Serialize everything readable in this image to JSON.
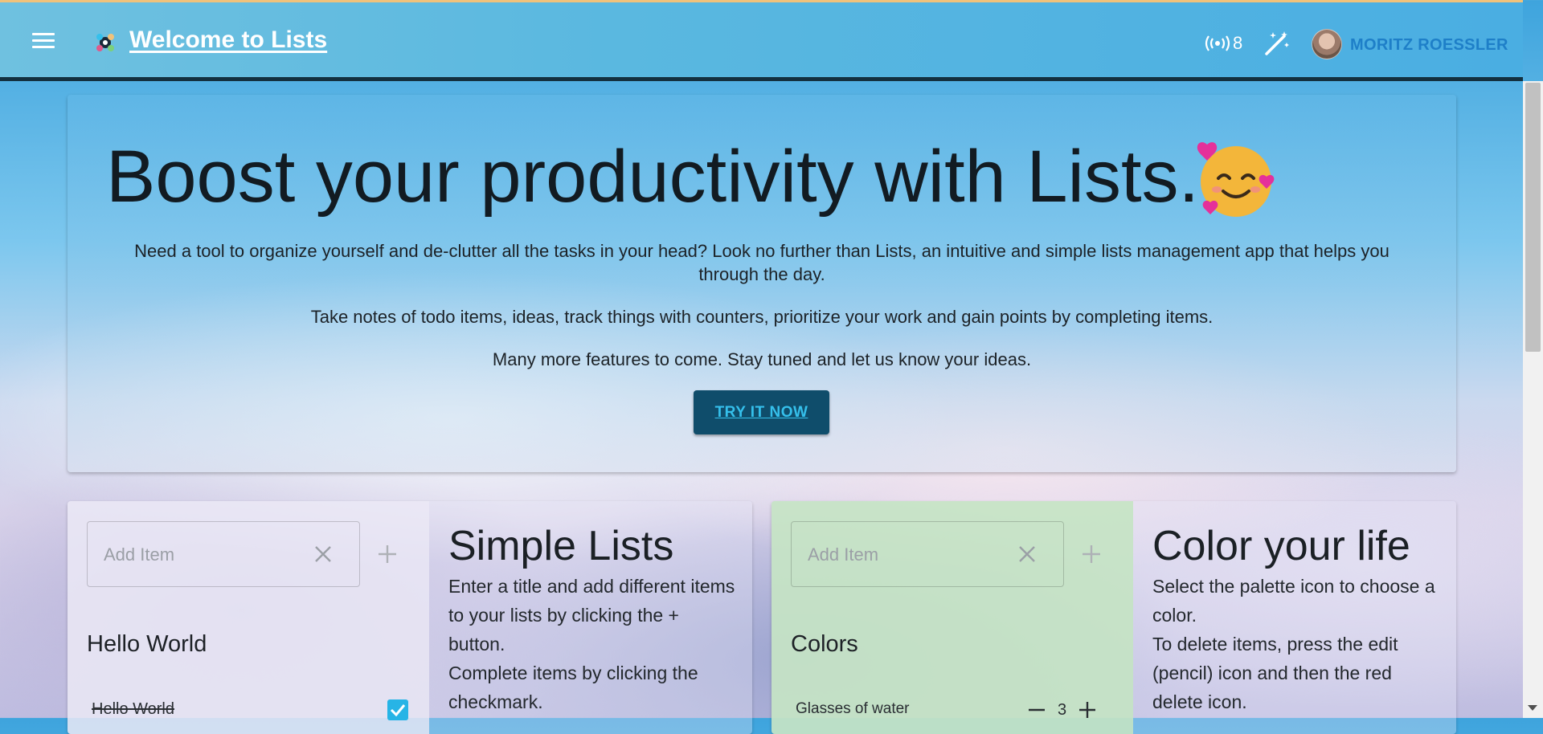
{
  "header": {
    "title": "Welcome to Lists",
    "online_count": "8",
    "user_name": "MORITZ ROESSLER"
  },
  "hero": {
    "headline": "Boost your productivity with Lists.",
    "paragraph1": "Need a tool to organize yourself and de-clutter all the tasks in your head? Look no further than Lists, an intuitive and simple lists management app that helps you through the day.",
    "paragraph2": "Take notes of todo items, ideas, track things with counters, prioritize your work and gain points by completing items.",
    "paragraph3": "Many more features to come. Stay tuned and let us know your ideas.",
    "cta_label": "TRY IT NOW"
  },
  "features": [
    {
      "add_placeholder": "Add Item",
      "list_title": "Hello World",
      "item_label": "Hello World",
      "item_completed": true,
      "heading": "Simple Lists",
      "description": "Enter a title and add different items to your lists by clicking the + button.\nComplete items by clicking the checkmark.",
      "card_color": "#e8e6f4"
    },
    {
      "add_placeholder": "Add Item",
      "list_title": "Colors",
      "item_label": "Glasses of water",
      "item_count": "3",
      "heading": "Color your life",
      "description": "Select the palette icon to choose a color.\nTo delete items, press the edit (pencil) icon and then the red delete icon.",
      "card_color": "#c6e4c4"
    }
  ],
  "colors": {
    "accent": "#27b4e6",
    "cta_bg": "#0f4d6b",
    "topbar": "#5ab8e0"
  }
}
